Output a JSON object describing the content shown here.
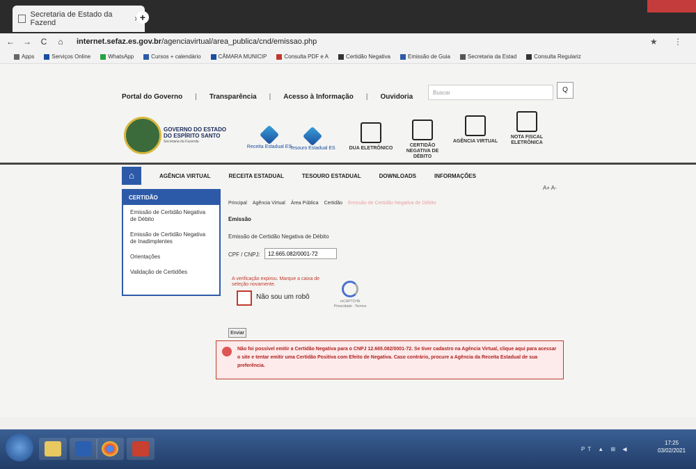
{
  "browser": {
    "tab_title": "Secretaria de Estado da Fazend",
    "tab_close": "×",
    "new_tab": "+",
    "back": "←",
    "forward": "→",
    "reload": "C",
    "home": "⌂",
    "url_host": "internet.sefaz.es.gov.br",
    "url_path": "/agenciavirtual/area_publica/cnd/emissao.php",
    "toolbar_right": "★ ⋮",
    "bookmarks": [
      {
        "label": "Apps",
        "color": "#666666"
      },
      {
        "label": "Serviços Online",
        "color": "#1a4ea0"
      },
      {
        "label": "WhatsApp",
        "color": "#25a244"
      },
      {
        "label": "Cursos + calendário",
        "color": "#2d5aa8"
      },
      {
        "label": "CÂMARA MUNICIP",
        "color": "#1a4ea0"
      },
      {
        "label": "Consulta PDF e A",
        "color": "#c0392b"
      },
      {
        "label": "Certidão Negativa",
        "color": "#333333"
      },
      {
        "label": "Emissão de Guia",
        "color": "#2d5aa8"
      },
      {
        "label": "Secretaria da Estad",
        "color": "#555555"
      },
      {
        "label": "Consulta Regulariz",
        "color": "#333333"
      }
    ]
  },
  "header": {
    "gov_links": [
      "Portal do Governo",
      "Transparência",
      "Acesso à Informação",
      "Ouvidoria"
    ],
    "separator": "|",
    "search_placeholder": "Buscar",
    "search_btn": "Q",
    "logo_line1": "GOVERNO DO ESTADO",
    "logo_line2": "DO ESPÍRITO SANTO",
    "logo_line3": "Secretaria da Fazenda",
    "services": [
      {
        "label": "Receita Estadual ES"
      },
      {
        "label": "Tesouro Estadual ES"
      },
      {
        "label": "DUA ELETRÔNICO"
      },
      {
        "label": "CERTIDÃO NEGATIVA DE DÉBITO"
      },
      {
        "label": "AGÊNCIA VIRTUAL"
      },
      {
        "label": "NOTA FISCAL ELETRÔNICA"
      }
    ]
  },
  "menu": {
    "home_icon": "⌂",
    "items": [
      "AGÊNCIA VIRTUAL",
      "RECEITA ESTADUAL",
      "TESOURO ESTADUAL",
      "DOWNLOADS",
      "INFORMAÇÕES"
    ],
    "font_size": "A+ A-"
  },
  "sidebar": {
    "title": "CERTIDÃO",
    "items": [
      "Emissão de Certidão Negativa de Débito",
      "Emissão de Certidão Negativa de Inadimplentes",
      "Orientações",
      "Validação de Certidões"
    ]
  },
  "main": {
    "breadcrumb": [
      "Principal",
      "Agência Virtual",
      "Área Pública",
      "Certidão",
      "Emissão de Certidão Negativa de Débito"
    ],
    "title": "Emissão",
    "subtitle": "Emissão de Certidão Negativa de Débito",
    "cpf_label": "CPF / CNPJ:",
    "cpf_value": "12.665.082/0001-72",
    "captcha_note": "A verificação expirou. Marque a caixa de seleção novamente.",
    "captcha_label": "Não sou um robô",
    "recaptcha_text": "reCAPTCHA Privacidade - Termos",
    "submit_label": "Enviar",
    "alert_text": "Não foi possível emitir a Certidão Negativa para o CNPJ 12.665.082/0001-72. Se tiver cadastro na Agência Virtual, clique aqui para acessar o site e tentar emitir uma Certidão Positiva com Efeito de Negativa. Caso contrário, procure a Agência da Receita Estadual de sua preferência."
  },
  "taskbar": {
    "time": "17:25",
    "date": "03/02/2021",
    "tray": "PT ▲ ⊞ ◀"
  }
}
